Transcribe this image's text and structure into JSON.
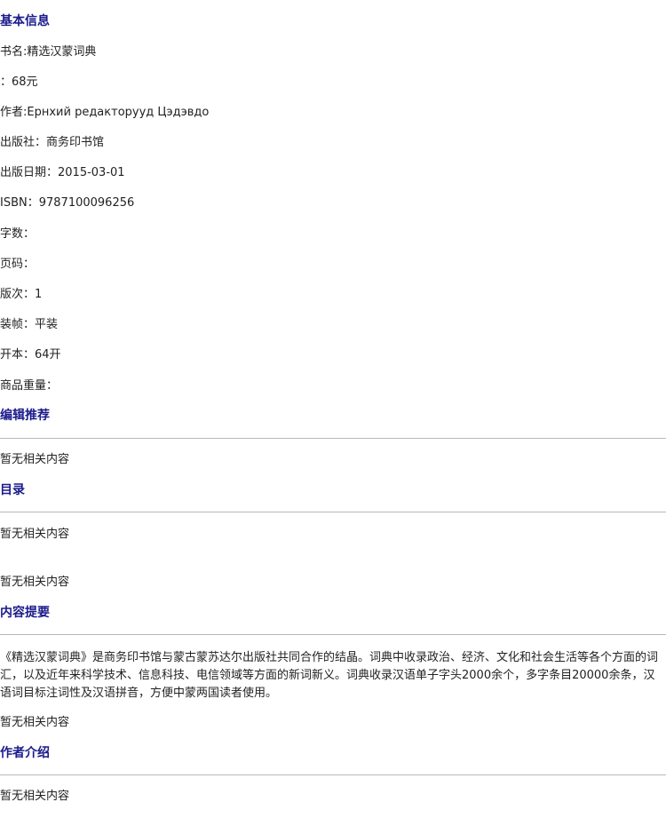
{
  "sections": {
    "basic_info": {
      "heading": "基本信息",
      "fields": {
        "title": "书名:精选汉蒙词典",
        "price": "：68元",
        "author": "作者:Ернхий редакторууд Цэдэвдо",
        "publisher": "出版社：商务印书馆",
        "pub_date": "出版日期：2015-03-01",
        "isbn": "ISBN：9787100096256",
        "word_count": "字数：",
        "page_count": "页码：",
        "edition": "版次：1",
        "binding": "装帧：平装",
        "format": "开本：64开",
        "weight": "商品重量："
      }
    },
    "editor_recommend": {
      "heading": "编辑推荐",
      "body": "暂无相关内容"
    },
    "toc": {
      "heading": "目录",
      "body1": "暂无相关内容",
      "body2": "暂无相关内容"
    },
    "summary": {
      "heading": "内容提要",
      "body": "《精选汉蒙词典》是商务印书馆与蒙古蒙苏达尔出版社共同合作的结晶。词典中收录政治、经济、文化和社会生活等各个方面的词汇，以及近年来科学技术、信息科技、电信领域等方面的新词新义。词典收录汉语单子字头2000余个，多字条目20000余条，汉语词目标注词性及汉语拼音，方便中蒙两国读者使用。",
      "after": "暂无相关内容"
    },
    "author_intro": {
      "heading": "作者介绍",
      "body": "暂无相关内容"
    }
  }
}
